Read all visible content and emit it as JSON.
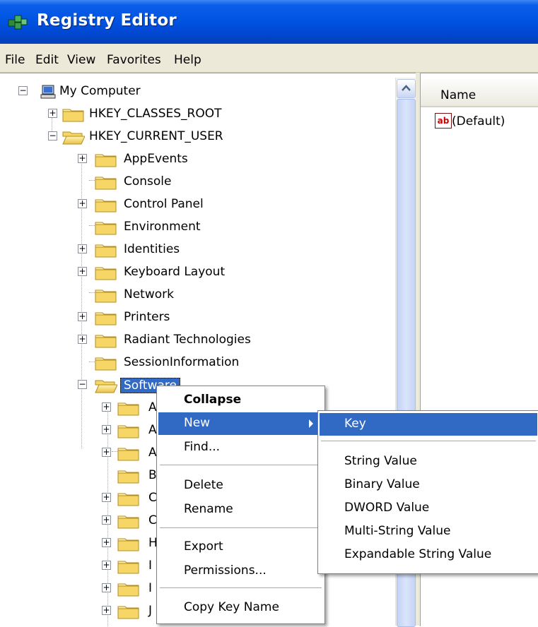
{
  "window": {
    "title": "Registry Editor"
  },
  "menubar": {
    "items": [
      "File",
      "Edit",
      "View",
      "Favorites",
      "Help"
    ]
  },
  "tree": {
    "root": "My Computer",
    "hives": [
      "HKEY_CLASSES_ROOT",
      "HKEY_CURRENT_USER"
    ],
    "hkcu_children": [
      "AppEvents",
      "Console",
      "Control Panel",
      "Environment",
      "Identities",
      "Keyboard Layout",
      "Network",
      "Printers",
      "Radiant Technologies",
      "SessionInformation",
      "Software"
    ],
    "software_children_visible": [
      "A",
      "A",
      "A",
      "B",
      "C",
      "C",
      "H",
      "I",
      "I",
      "J"
    ]
  },
  "right_pane": {
    "column_header": "Name",
    "values": [
      {
        "icon": "ab",
        "name": "(Default)"
      }
    ]
  },
  "context_menu": {
    "items": [
      {
        "label": "Collapse",
        "bold": true
      },
      {
        "label": "New",
        "submenu": true,
        "highlighted": true
      },
      {
        "label": "Find..."
      },
      {
        "label": "Delete"
      },
      {
        "label": "Rename"
      },
      {
        "label": "Export"
      },
      {
        "label": "Permissions..."
      },
      {
        "label": "Copy Key Name"
      }
    ]
  },
  "new_submenu": {
    "items": [
      "Key",
      "String Value",
      "Binary Value",
      "DWORD Value",
      "Multi-String Value",
      "Expandable String Value"
    ]
  },
  "colors": {
    "title_bar": "#0054e3",
    "menu_bar": "#ece9d8",
    "highlight": "#316ac5",
    "folder": "#f5d56a"
  }
}
